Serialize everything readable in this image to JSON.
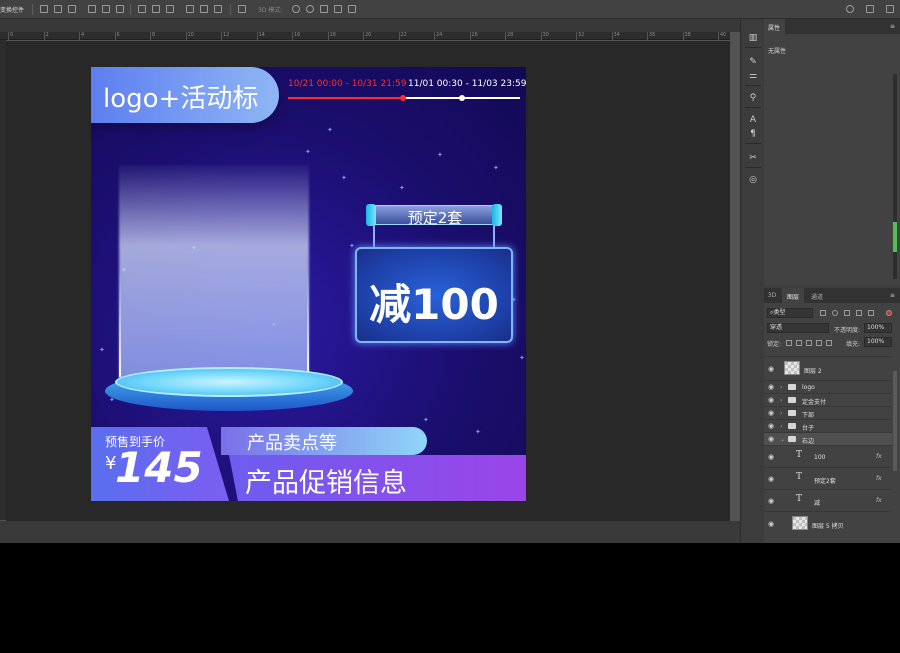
{
  "options_bar": {
    "label": "变换控件",
    "mode_3d": "3D 模式:"
  },
  "ruler": {
    "ticks": [
      "0",
      "2",
      "4",
      "6",
      "8",
      "10",
      "12",
      "14",
      "16",
      "18",
      "20",
      "22",
      "24",
      "26",
      "28",
      "30",
      "32",
      "34",
      "36",
      "38",
      "40"
    ]
  },
  "artwork": {
    "logo_text": "logo+活动标",
    "timeline": {
      "phase1": "10/21 00:00 - 10/31 21:59",
      "phase2": "11/01 00:30 - 11/03 23:59"
    },
    "sign_tag": "预定2套",
    "sign_main": "减100",
    "presale_label": "预售到手价",
    "currency": "¥",
    "price": "145",
    "selling_points": "产品卖点等",
    "promo": "产品促销信息"
  },
  "properties": {
    "tab": "属性",
    "empty": "无属性"
  },
  "layers_panel": {
    "tabs": [
      "3D",
      "图层",
      "通道"
    ],
    "filter_kind": "类型",
    "blend_mode": "穿透",
    "opacity_label": "不透明度:",
    "opacity_value": "100%",
    "lock_label": "锁定:",
    "fill_label": "填充:",
    "fill_value": "100%",
    "layers": [
      {
        "name": "图层 2",
        "kind": "pixel"
      },
      {
        "name": "logo",
        "kind": "group"
      },
      {
        "name": "定金支付",
        "kind": "group"
      },
      {
        "name": "下部",
        "kind": "group"
      },
      {
        "name": "台子",
        "kind": "group"
      },
      {
        "name": "右边",
        "kind": "group-open"
      },
      {
        "name": "100",
        "kind": "text"
      },
      {
        "name": "预定2套",
        "kind": "text"
      },
      {
        "name": "减",
        "kind": "text"
      },
      {
        "name": "图层 5 拷贝",
        "kind": "pixel"
      }
    ],
    "fx_label": "fx"
  }
}
